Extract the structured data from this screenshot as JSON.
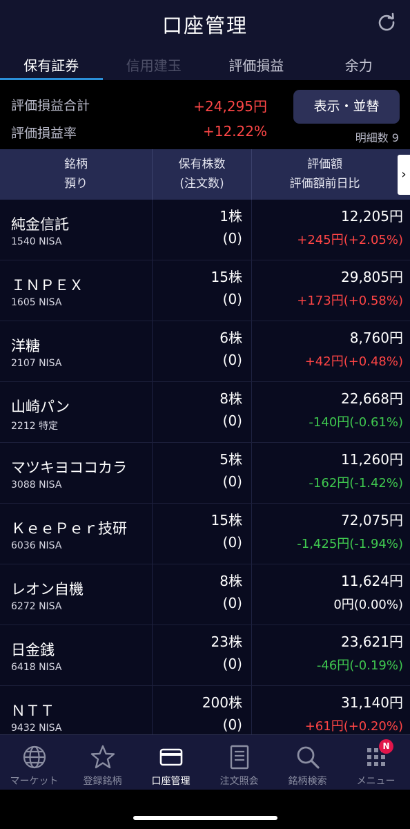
{
  "header": {
    "title": "口座管理"
  },
  "tabs": [
    {
      "label": "保有証券",
      "state": "active"
    },
    {
      "label": "信用建玉",
      "state": "disabled"
    },
    {
      "label": "評価損益",
      "state": "normal"
    },
    {
      "label": "余力",
      "state": "normal"
    }
  ],
  "summary": {
    "total_label": "評価損益合計",
    "total_value": "+24,295円",
    "rate_label": "評価損益率",
    "rate_value": "+12.22%",
    "display_button": "表示・並替",
    "detail_count": "明細数 9"
  },
  "table_header": {
    "col1_line1": "銘柄",
    "col1_line2": "預り",
    "col2_line1": "保有株数",
    "col2_line2": "(注文数)",
    "col3_line1": "評価額",
    "col3_line2": "評価額前日比",
    "next_glyph": "›"
  },
  "holdings": [
    {
      "name": "純金信託",
      "code": "1540 NISA",
      "qty": "1株",
      "orders": "(0)",
      "value": "12,205円",
      "change": "+245円(+2.05%)",
      "trend": "pos"
    },
    {
      "name": "ＩＮＰＥＸ",
      "code": "1605 NISA",
      "qty": "15株",
      "orders": "(0)",
      "value": "29,805円",
      "change": "+173円(+0.58%)",
      "trend": "pos"
    },
    {
      "name": "洋糖",
      "code": "2107 NISA",
      "qty": "6株",
      "orders": "(0)",
      "value": "8,760円",
      "change": "+42円(+0.48%)",
      "trend": "pos"
    },
    {
      "name": "山崎パン",
      "code": "2212 特定",
      "qty": "8株",
      "orders": "(0)",
      "value": "22,668円",
      "change": "-140円(-0.61%)",
      "trend": "neg"
    },
    {
      "name": "マツキヨココカラ",
      "code": "3088 NISA",
      "qty": "5株",
      "orders": "(0)",
      "value": "11,260円",
      "change": "-162円(-1.42%)",
      "trend": "neg"
    },
    {
      "name": "ＫｅｅＰｅｒ技研",
      "code": "6036 NISA",
      "qty": "15株",
      "orders": "(0)",
      "value": "72,075円",
      "change": "-1,425円(-1.94%)",
      "trend": "neg"
    },
    {
      "name": "レオン自機",
      "code": "6272 NISA",
      "qty": "8株",
      "orders": "(0)",
      "value": "11,624円",
      "change": "0円(0.00%)",
      "trend": "zero"
    },
    {
      "name": "日金銭",
      "code": "6418 NISA",
      "qty": "23株",
      "orders": "(0)",
      "value": "23,621円",
      "change": "-46円(-0.19%)",
      "trend": "neg"
    },
    {
      "name": "ＮＴＴ",
      "code": "9432 NISA",
      "qty": "200株",
      "orders": "(0)",
      "value": "31,140円",
      "change": "+61円(+0.20%)",
      "trend": "pos"
    }
  ],
  "bottom_nav": [
    {
      "label": "マーケット",
      "icon": "globe-icon",
      "active": false
    },
    {
      "label": "登録銘柄",
      "icon": "star-icon",
      "active": false
    },
    {
      "label": "口座管理",
      "icon": "card-icon",
      "active": true
    },
    {
      "label": "注文照会",
      "icon": "document-icon",
      "active": false
    },
    {
      "label": "銘柄検索",
      "icon": "search-icon",
      "active": false
    },
    {
      "label": "メニュー",
      "icon": "grid-menu-icon",
      "active": false,
      "badge": "N"
    }
  ],
  "colors": {
    "positive": "#ff4545",
    "negative": "#3fc84f",
    "accent": "#2b8fd8",
    "header_bg": "#12142e"
  }
}
